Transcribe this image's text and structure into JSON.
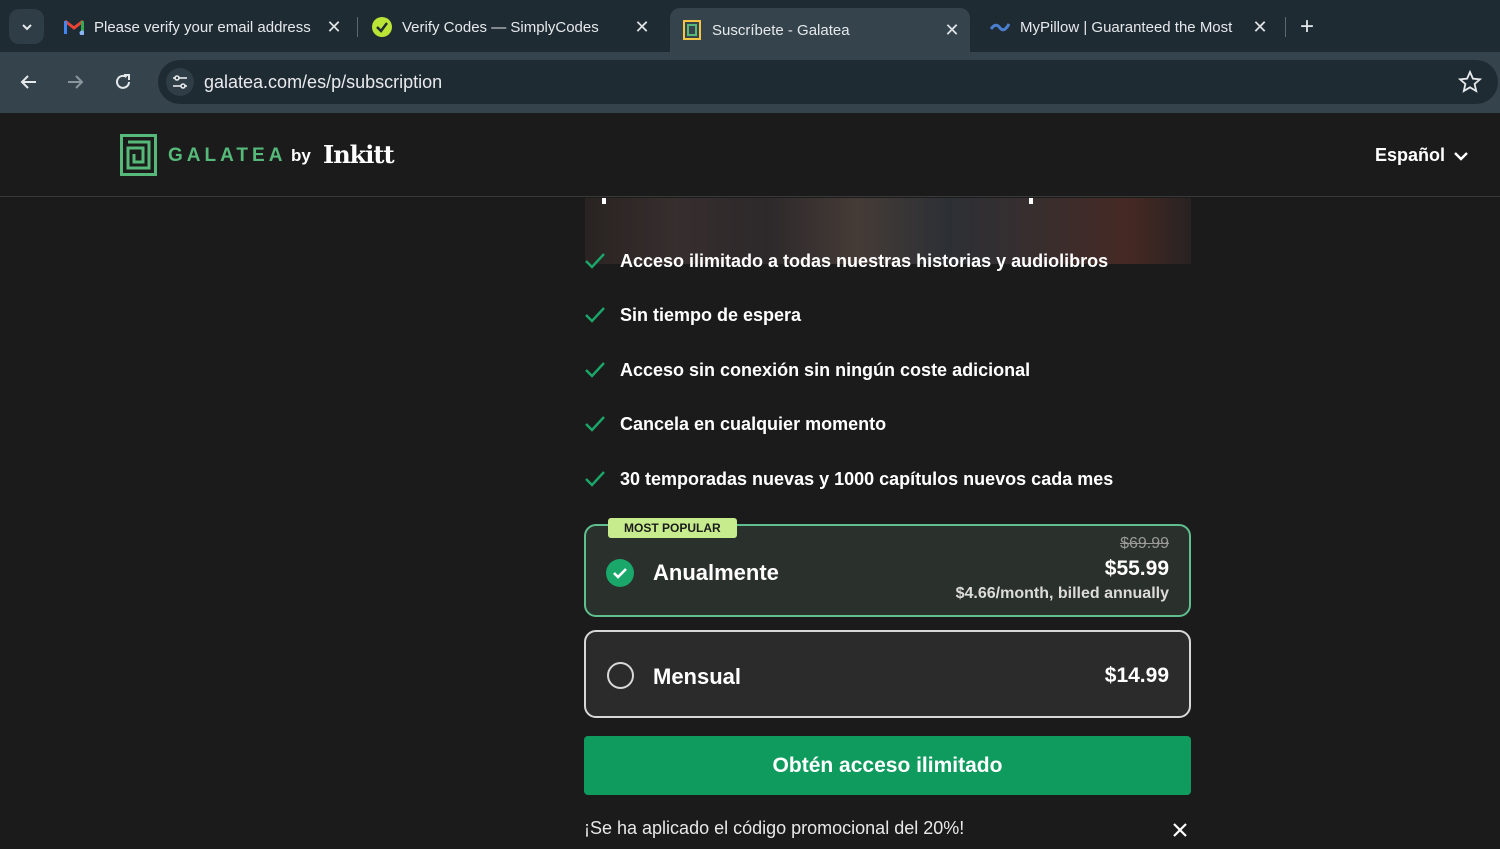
{
  "browser": {
    "tabs": [
      {
        "title": "Please verify your email address",
        "favicon": "gmail-icon",
        "active": false
      },
      {
        "title": "Verify Codes — SimplyCodes",
        "favicon": "simplycodes-icon",
        "active": false
      },
      {
        "title": "Suscríbete - Galatea",
        "favicon": "galatea-icon",
        "active": true
      },
      {
        "title": "MyPillow | Guaranteed the Most",
        "favicon": "mypillow-icon",
        "active": false
      }
    ],
    "url": "galatea.com/es/p/subscription"
  },
  "header": {
    "logo_text": "GALATEA",
    "logo_by": "by",
    "logo_brand": "Inkitt",
    "language": "Español"
  },
  "features": [
    "Acceso ilimitado a todas nuestras historias y audiolibros",
    "Sin tiempo de espera",
    "Acceso sin conexión sin ningún coste adicional",
    "Cancela en cualquier momento",
    "30 temporadas nuevas y 1000 capítulos nuevos cada mes"
  ],
  "plans": {
    "annual": {
      "badge": "MOST POPULAR",
      "name": "Anualmente",
      "old_price": "$69.99",
      "price": "$55.99",
      "sub": "$4.66/month, billed annually",
      "selected": true
    },
    "monthly": {
      "name": "Mensual",
      "price": "$14.99",
      "selected": false
    }
  },
  "cta": "Obtén acceso ilimitado",
  "promo": "¡Se ha aplicado el código promocional del 20%!",
  "colors": {
    "accent_green": "#0f9a5e",
    "check_green": "#1aa76a",
    "badge": "#c6ec8e",
    "background": "#1b1b1b"
  }
}
